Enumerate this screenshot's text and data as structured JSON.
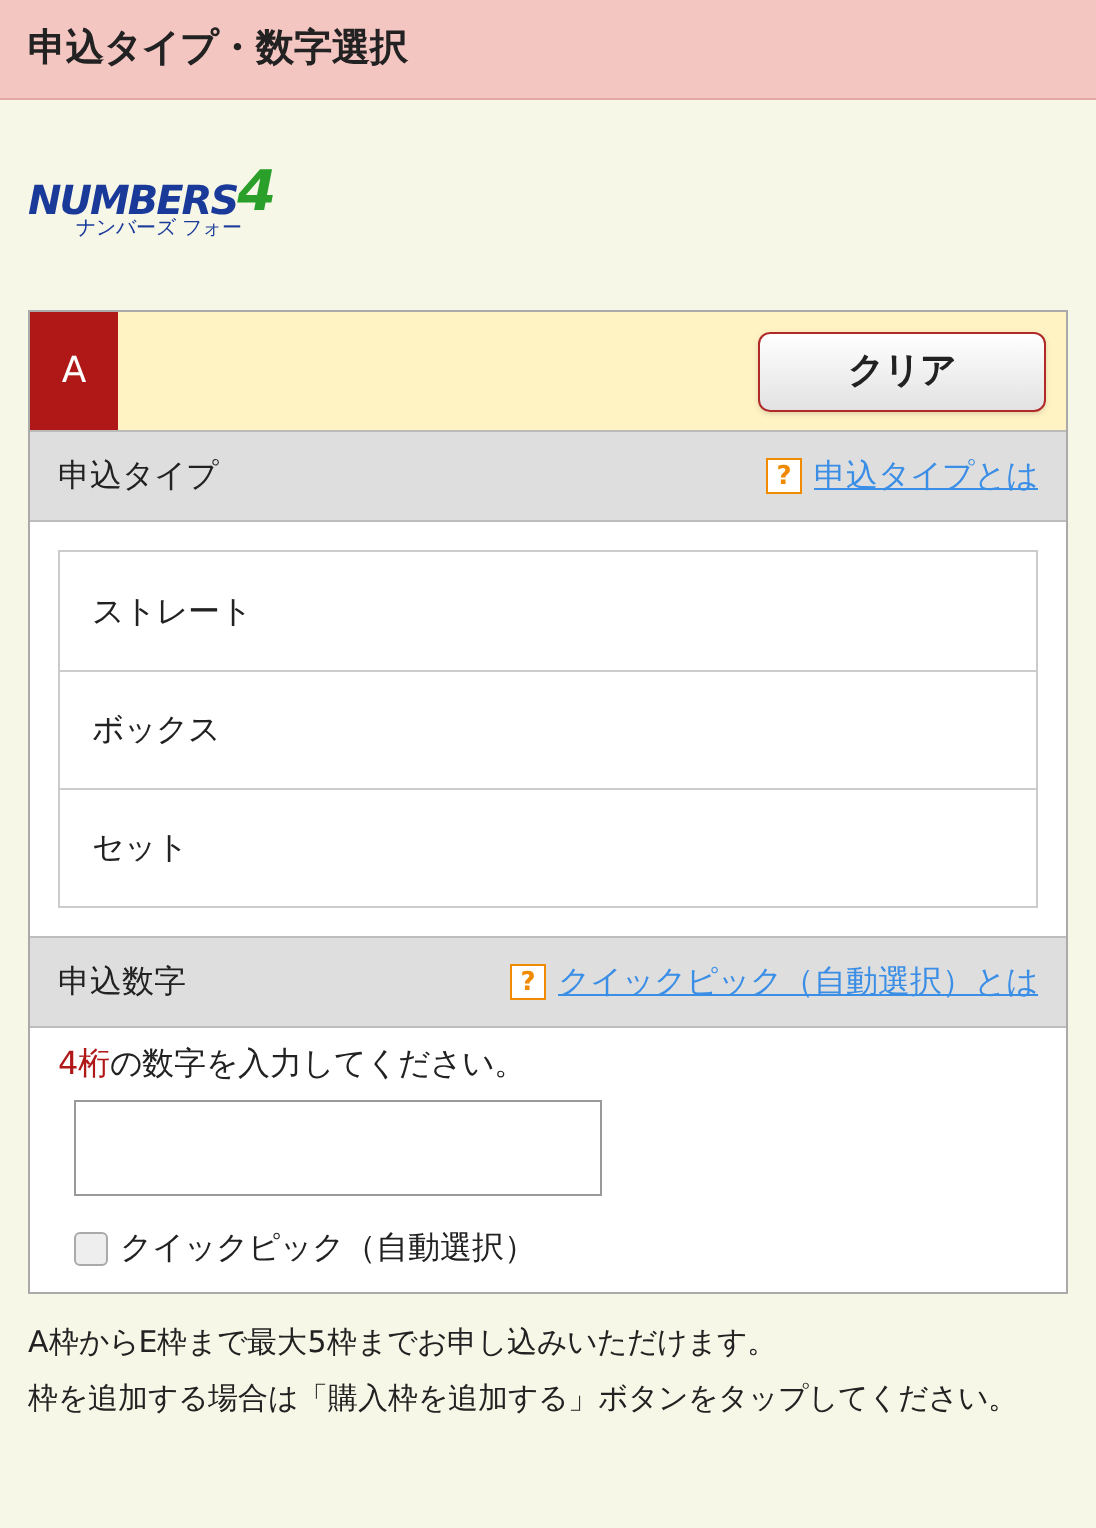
{
  "header": {
    "title": "申込タイプ・数字選択"
  },
  "logo": {
    "word": "NUMBERS",
    "digit": "4",
    "reading": "ナンバーズ フォー"
  },
  "slot": {
    "label": "A",
    "clear_button": "クリア"
  },
  "type_section": {
    "title": "申込タイプ",
    "help_link": "申込タイプとは",
    "help_mark": "?",
    "options": [
      {
        "label": "ストレート",
        "selected": false
      },
      {
        "label": "ボックス",
        "selected": false
      },
      {
        "label": "セット",
        "selected": false
      }
    ]
  },
  "number_section": {
    "title": "申込数字",
    "help_link": "クイックピック（自動選択）とは",
    "help_mark": "?",
    "prompt_highlight": "4桁",
    "prompt_rest": "の数字を入力してください。",
    "quick_pick": {
      "label": "クイックピック（自動選択）",
      "checked": false
    }
  },
  "notes": [
    "A枠からE枠まで最大5枠までお申し込みいただけます。",
    "枠を追加する場合は「購入枠を追加する」ボタンをタップしてください。"
  ]
}
